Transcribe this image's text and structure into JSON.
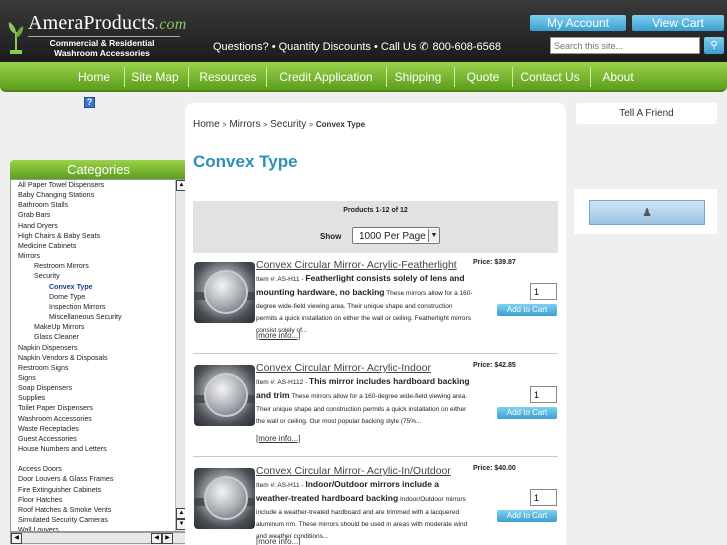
{
  "header": {
    "brand": "AmeraProducts",
    "brand_suffix": ".com",
    "tagline_1": "Commercial & Residential",
    "tagline_2": "Washroom Accessories",
    "contact_line": "Questions? • Quantity Discounts • Call Us",
    "phone": "800-608-6568",
    "my_account": "My Account",
    "view_cart": "View Cart",
    "search_placeholder": "Search this site...",
    "search_button_icon": "search-icon"
  },
  "nav": [
    "Home",
    "Site Map",
    "Resources",
    "Credit Application",
    "Shipping",
    "Quote",
    "Contact Us",
    "About"
  ],
  "sidebar": {
    "help_icon": "?",
    "categories_title": "Categories",
    "categories": [
      "All Paper Towel Dispensers",
      "Baby Changing Stations",
      "Bathroom Stalls",
      "Grab Bars",
      "Hand Dryers",
      "High Chairs & Baby Seats",
      "Medicine Cabinets",
      "Mirrors",
      "Restroom Mirrors",
      "Security",
      "Convex Type",
      "Dome Type",
      "Inspection Mirrors",
      "Miscellaneous Security",
      "MakeUp Mirrors",
      "Glass Cleaner",
      "Napkin Dispensers",
      "Napkin Vendors & Disposals",
      "Restroom Signs",
      "Signs",
      "Soap Dispensers",
      "Supplies",
      "Toilet Paper Dispensers",
      "Washroom Accessories",
      "Waste Receptacles",
      "Guest Accessories",
      "House Numbers and Letters",
      "Access Doors",
      "Door Louvers & Glass Frames",
      "Fire Extinguisher Cabinets",
      "Floor Hatches",
      "Roof Hatches & Smoke Vents",
      "Simulated Security Cameras",
      "Wall Louvers"
    ]
  },
  "main": {
    "breadcrumb": [
      "Home",
      "Mirrors",
      "Security",
      "Convex Type"
    ],
    "title": "Convex Type",
    "count_text": "Products 1-12 of 12",
    "show_label": "Show",
    "per_page": "1000 Per Page",
    "more_info": "[more info...]",
    "add_to_cart": "Add to Cart",
    "products": [
      {
        "name": "Convex Circular Mirror- Acrylic-Featherlight",
        "price": "Price: $39.87",
        "item_no": "Item #: AS-H11",
        "headline": "Featherlight consists solely of lens and mounting hardware, no backing",
        "desc": "These mirrors allow for a 160-degree wide-field viewing area.  Their unique shape and construction permits a quick installation on either the wall or ceiling.  Featherlight mirrors consist solely of...",
        "qty": "1"
      },
      {
        "name": "Convex Circular Mirror- Acrylic-Indoor",
        "price": "Price: $42.85",
        "item_no": "Item #: AS-H112",
        "headline": "This mirror includes hardboard backing and trim",
        "desc": "These mirrors allow for a 160-degree wide-field viewing area.  Their unique shape and construction permits a quick installation on either the wall or ceiling.   Our most popular backing style (75%...",
        "qty": "1"
      },
      {
        "name": "Convex Circular Mirror- Acrylic-In/Outdoor",
        "price": "Price: $40.00",
        "item_no": "Item #: AS-H11",
        "headline": "Indoor/Outdoor mirrors include a weather-treated hardboard backing",
        "desc": "Indoor/Outdoor mirrors include a weather-treated hardboard and are trimmed with a lacquered aluminum rim.  These mirrors should be used in areas with moderate wind and weather conditions...",
        "qty": "1"
      }
    ]
  },
  "right": {
    "tell_friend": "Tell A Friend",
    "panel_icon": "user-icon"
  },
  "colors": {
    "nav_green": "#7ab834",
    "accent_blue": "#3a9fd0",
    "title_blue": "#2e8fbc"
  }
}
